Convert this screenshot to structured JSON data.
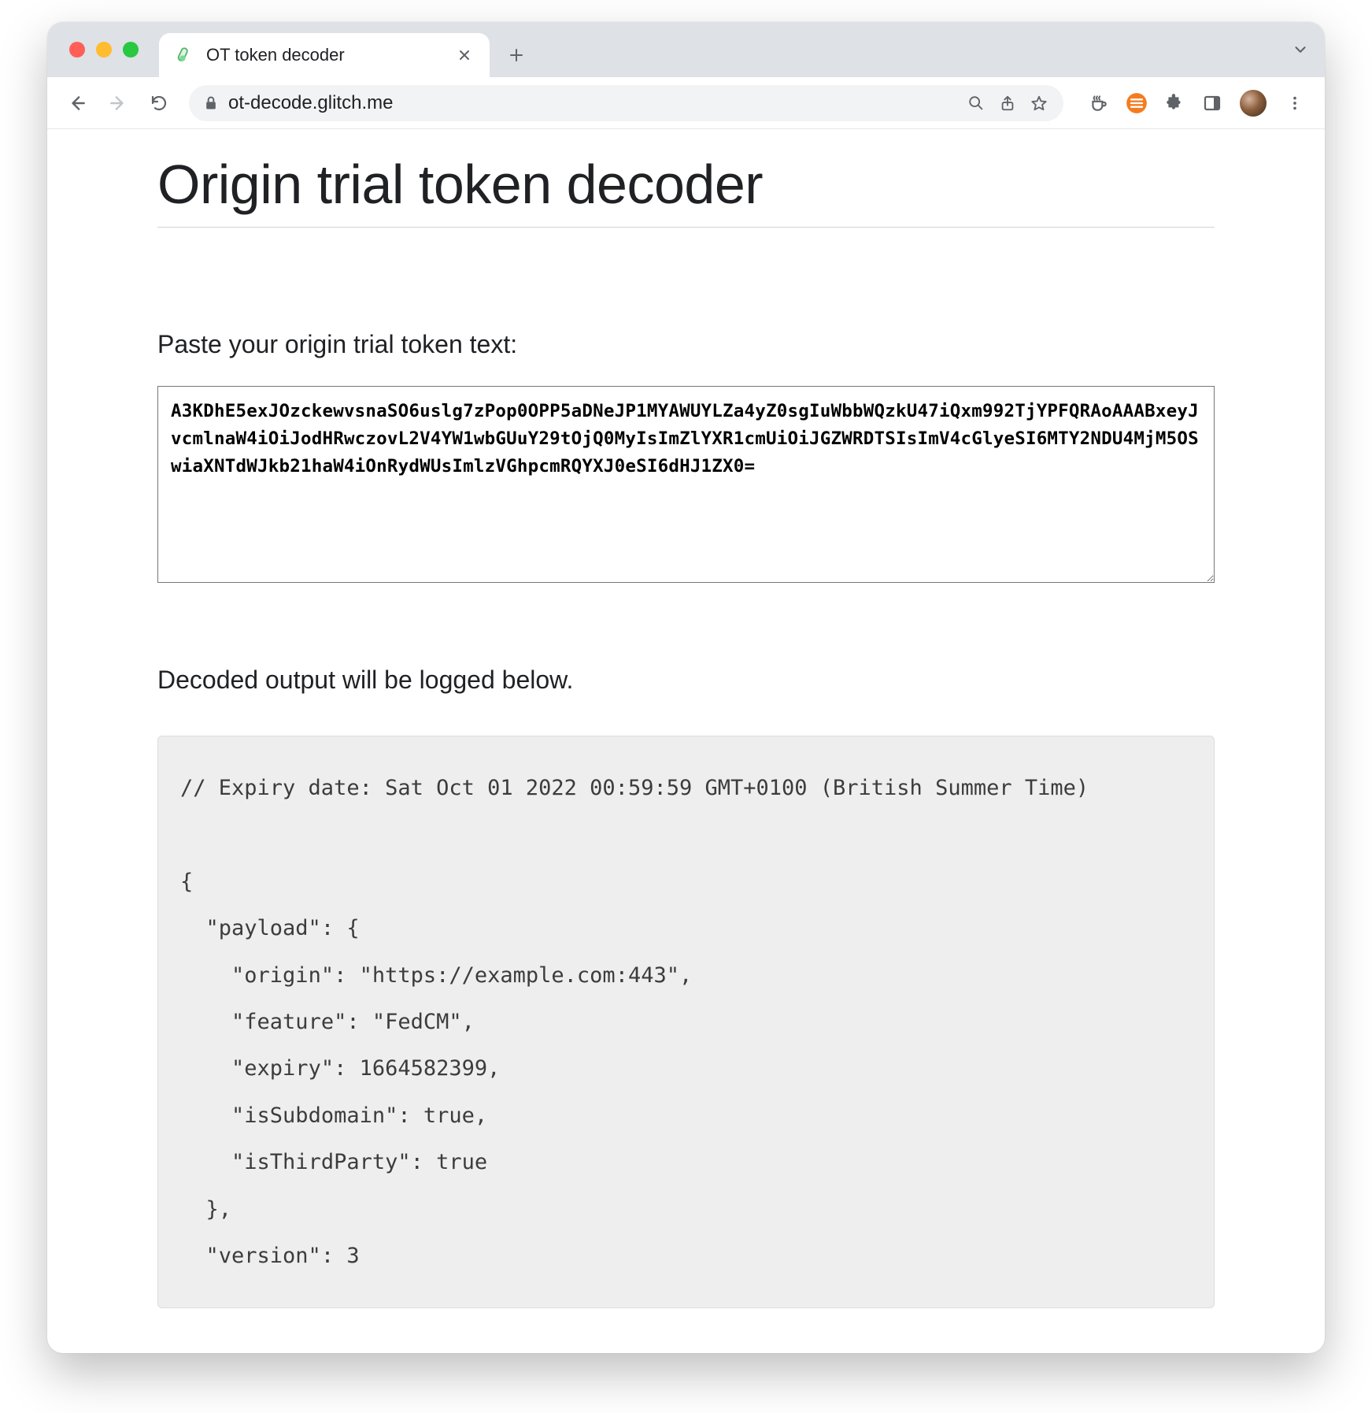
{
  "browser": {
    "tab_title": "OT token decoder",
    "url": "ot-decode.glitch.me"
  },
  "page": {
    "heading": "Origin trial token decoder",
    "input_label": "Paste your origin trial token text:",
    "token_value": "A3KDhE5exJOzckewvsnaSO6uslg7zPop0OPP5aDNeJP1MYAWUYLZa4yZ0sgIuWbbWQzkU47iQxm992TjYPFQRAoAAABxeyJvcmlnaW4iOiJodHRwczovL2V4YW1wbGUuY29tOjQ0MyIsImZlYXR1cmUiOiJGZWRDTSIsImV4cGlyeSI6MTY2NDU4MjM5OSwiaXNTdWJkb21haW4iOnRydWUsImlzVGhpcmRQYXJ0eSI6dHJ1ZX0=",
    "output_label": "Decoded output will be logged below.",
    "output_text": "// Expiry date: Sat Oct 01 2022 00:59:59 GMT+0100 (British Summer Time)\n\n{\n  \"payload\": {\n    \"origin\": \"https://example.com:443\",\n    \"feature\": \"FedCM\",\n    \"expiry\": 1664582399,\n    \"isSubdomain\": true,\n    \"isThirdParty\": true\n  },\n  \"version\": 3"
  }
}
